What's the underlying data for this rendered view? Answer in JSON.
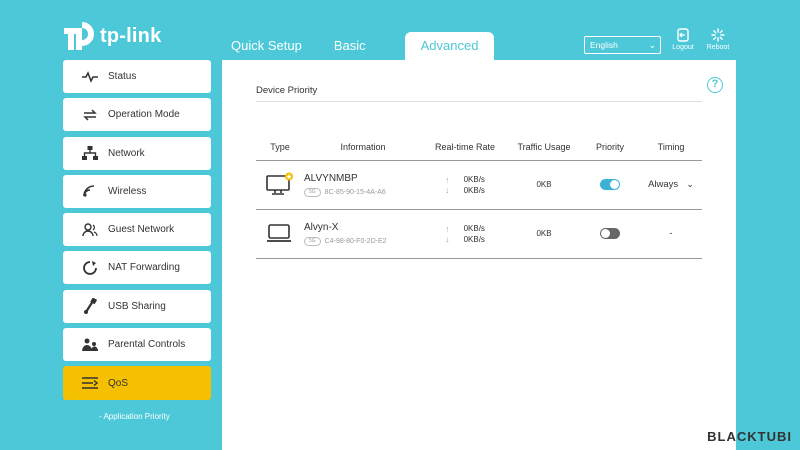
{
  "brand": {
    "logo_text": "tp-link",
    "accent": "#4cc8d8",
    "highlight": "#f5c000"
  },
  "tabs": [
    {
      "label": "Quick Setup",
      "active": false
    },
    {
      "label": "Basic",
      "active": false
    },
    {
      "label": "Advanced",
      "active": true
    }
  ],
  "header": {
    "language": "English",
    "logout_label": "Logout",
    "reboot_label": "Reboot"
  },
  "sidebar": {
    "items": [
      {
        "label": "Status",
        "icon": "pulse-icon"
      },
      {
        "label": "Operation Mode",
        "icon": "swap-icon"
      },
      {
        "label": "Network",
        "icon": "network-icon"
      },
      {
        "label": "Wireless",
        "icon": "wifi-icon"
      },
      {
        "label": "Guest Network",
        "icon": "guest-icon"
      },
      {
        "label": "NAT Forwarding",
        "icon": "nat-icon"
      },
      {
        "label": "USB Sharing",
        "icon": "usb-icon"
      },
      {
        "label": "Parental Controls",
        "icon": "family-icon"
      },
      {
        "label": "QoS",
        "icon": "qos-icon",
        "active": true
      }
    ],
    "sub_items": [
      {
        "label": "- Application Priority"
      }
    ]
  },
  "main": {
    "section_title": "Device Priority",
    "columns": [
      "Type",
      "Information",
      "Real-time Rate",
      "Traffic Usage",
      "Priority",
      "Timing"
    ],
    "rows": [
      {
        "name": "ALVYNMBP",
        "band": "5G",
        "mac": "8C-85-90-15-4A-A6",
        "up": "0KB/s",
        "down": "0KB/s",
        "usage": "0KB",
        "priority": true,
        "timing": "Always",
        "device": "desktop-icon"
      },
      {
        "name": "Alvyn-X",
        "band": "5G",
        "mac": "C4-98-80-F0-2D-E2",
        "up": "0KB/s",
        "down": "0KB/s",
        "usage": "0KB",
        "priority": false,
        "timing": "-",
        "device": "laptop-icon"
      }
    ]
  },
  "watermark": "BLACKTUBI"
}
